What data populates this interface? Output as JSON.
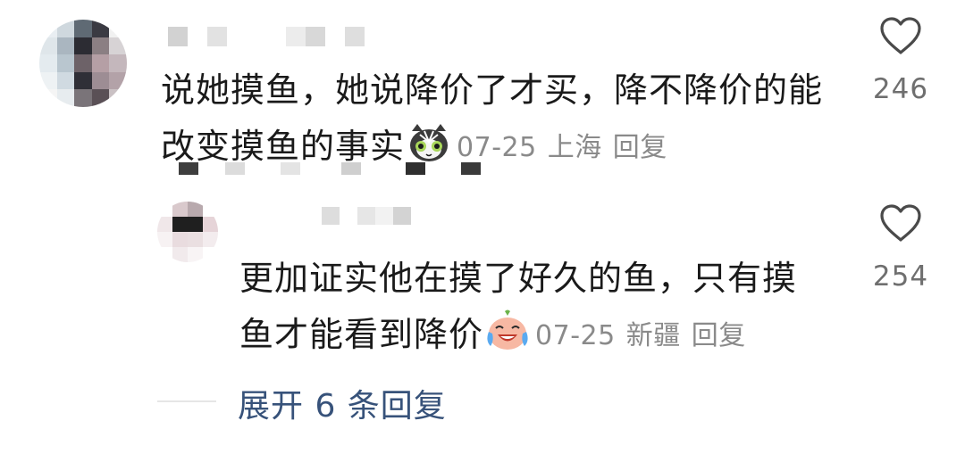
{
  "comments": [
    {
      "text": "说她摸鱼，她说降价了才买，降不降价的能改变摸鱼的事实",
      "emoji": "cat-emoji",
      "date": "07-25",
      "location": "上海",
      "reply_label": "回复",
      "likes": "246"
    }
  ],
  "reply": {
    "text": "更加证实他在摸了好久的鱼，只有摸鱼才能看到降价",
    "emoji": "laughing-tears-emoji",
    "date": "07-25",
    "location": "新疆",
    "reply_label": "回复",
    "likes": "254"
  },
  "expand": {
    "label": "展开 6 条回复"
  },
  "colors": {
    "text": "#1a1a1a",
    "meta": "#8a8a8a",
    "link": "#37527a",
    "like_count": "#6f6f6f"
  }
}
